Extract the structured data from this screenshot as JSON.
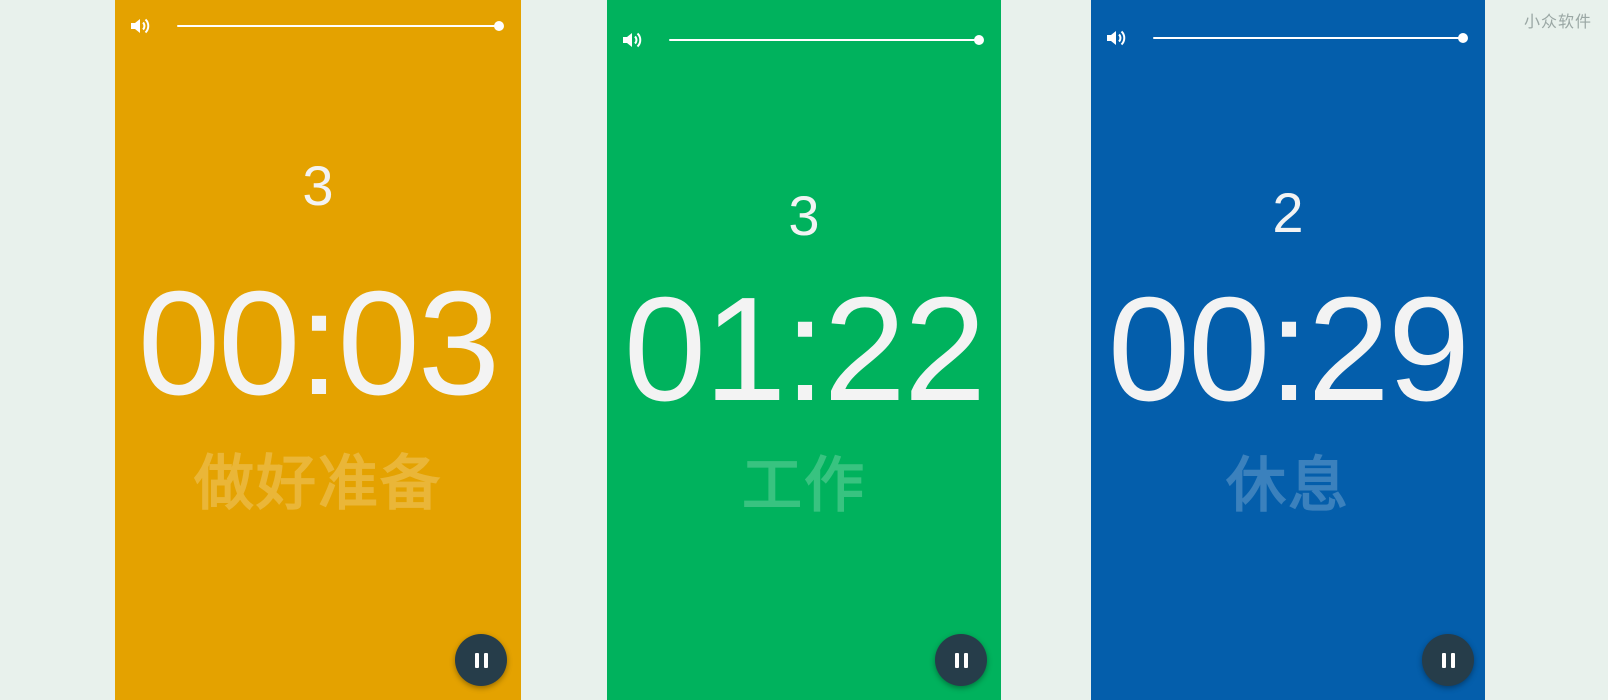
{
  "watermark": "小众软件",
  "screens": [
    {
      "color": "#e4a200",
      "round": "3",
      "time": "00:03",
      "phase": "做好准备",
      "volume_level": 1.0
    },
    {
      "color": "#00b25d",
      "round": "3",
      "time": "01:22",
      "phase": "工作",
      "volume_level": 1.0
    },
    {
      "color": "#045eab",
      "round": "2",
      "time": "00:29",
      "phase": "休息",
      "volume_level": 1.0
    }
  ],
  "icons": {
    "volume": "speaker-icon",
    "pause": "pause-icon"
  }
}
